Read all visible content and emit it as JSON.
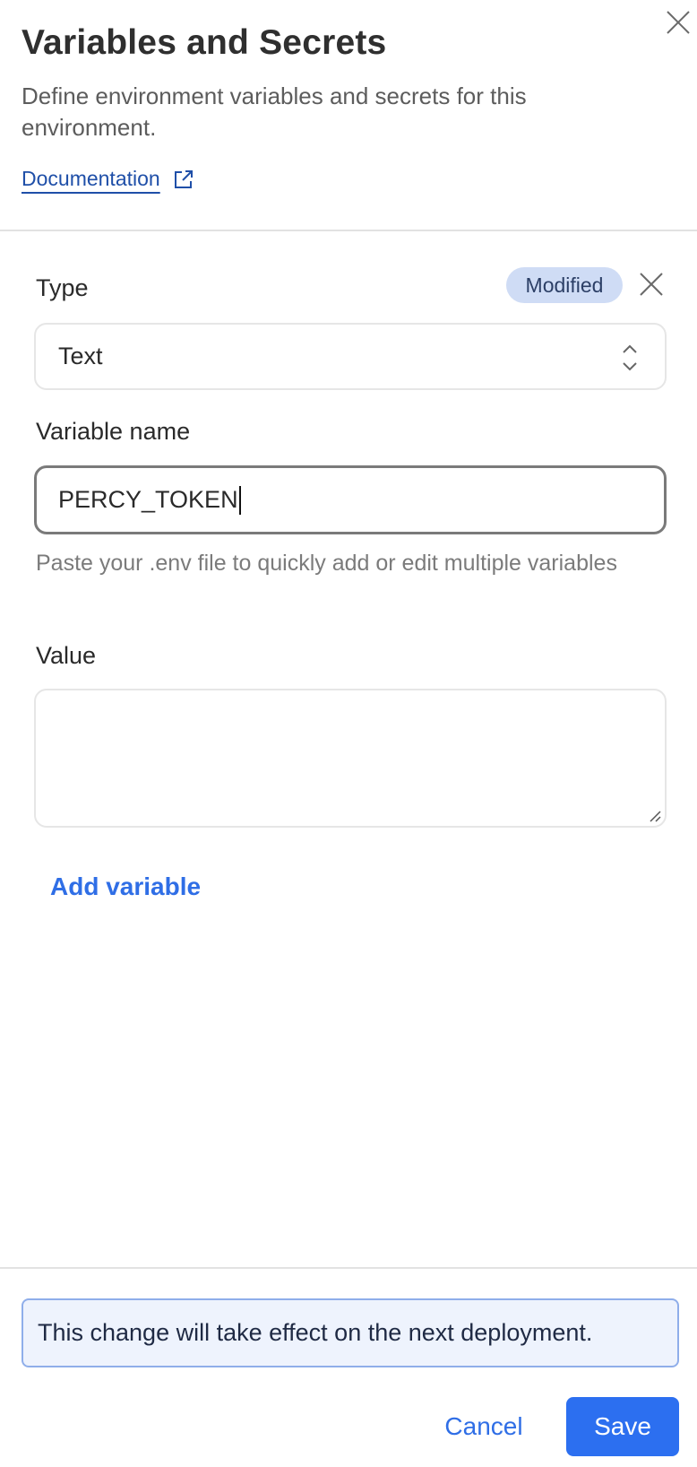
{
  "header": {
    "title": "Variables and Secrets",
    "subtitle": "Define environment variables and secrets for this environment.",
    "doc_link": "Documentation"
  },
  "form": {
    "type_label": "Type",
    "status_badge": "Modified",
    "type_value": "Text",
    "variable_name_label": "Variable name",
    "variable_name_value": "PERCY_TOKEN",
    "help_text": "Paste your .env file to quickly add or edit multiple variables",
    "value_label": "Value",
    "value_value": "",
    "add_variable": "Add variable"
  },
  "footer": {
    "notice": "This change will take effect on the next deployment.",
    "cancel": "Cancel",
    "save": "Save"
  },
  "icons": {
    "close": "close-icon",
    "external_link": "external-link-icon",
    "select_chevrons": "chevron-up-down-icon",
    "resize": "resize-grip-icon"
  },
  "colors": {
    "accent": "#2f6ee6",
    "link": "#1f4fa8",
    "badge_bg": "#cfdcf5",
    "notice_bg": "#eef3fd",
    "notice_border": "#8faeea"
  }
}
